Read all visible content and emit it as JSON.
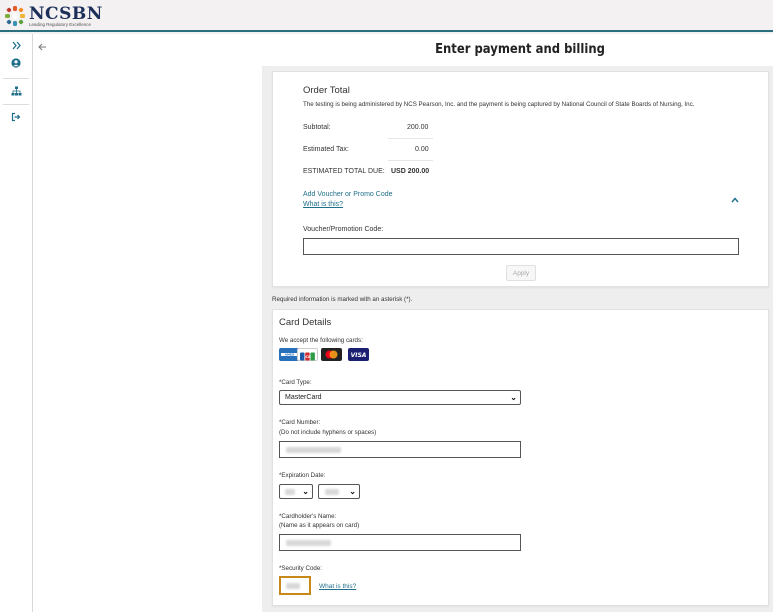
{
  "brand": {
    "name": "NCSBN",
    "tagline": "Leading Regulatory Excellence"
  },
  "nav": {
    "icons": [
      "expand-icon",
      "user-icon",
      "sitemap-icon",
      "logout-icon"
    ]
  },
  "page": {
    "title": "Enter payment and billing"
  },
  "order": {
    "heading": "Order Total",
    "notice": "The testing is being administered by NCS Pearson, Inc. and the payment is being captured by National Council of State Boards of Nursing, Inc.",
    "subtotal_label": "Subtotal:",
    "subtotal_value": "200.00",
    "tax_label": "Estimated Tax:",
    "tax_value": "0.00",
    "total_label": "ESTIMATED TOTAL DUE:",
    "total_value": "USD 200.00",
    "voucher_toggle": "Add Voucher or Promo Code",
    "voucher_help": "What is this?",
    "voucher_label": "Voucher/Promotion Code:",
    "voucher_value": "",
    "apply_label": "Apply"
  },
  "required_note": "Required information is marked with an asterisk (*).",
  "card_details": {
    "heading": "Card Details",
    "accepted_label": "We accept the following cards:",
    "cards": [
      "amex",
      "jcb",
      "mastercard",
      "visa"
    ],
    "card_type_label": "*Card Type:",
    "card_type_value": "MasterCard",
    "card_number_label": "*Card Number:",
    "card_number_hint": "(Do not include hyphens or spaces)",
    "expiration_label": "*Expiration Date:",
    "cardholder_label": "*Cardholder's Name:",
    "cardholder_hint": "(Name as it appears on card)",
    "security_label": "*Security Code:",
    "security_help": "What is this?"
  },
  "colors": {
    "accent": "#1f6f8b",
    "header_rule": "#2a6f7c"
  }
}
